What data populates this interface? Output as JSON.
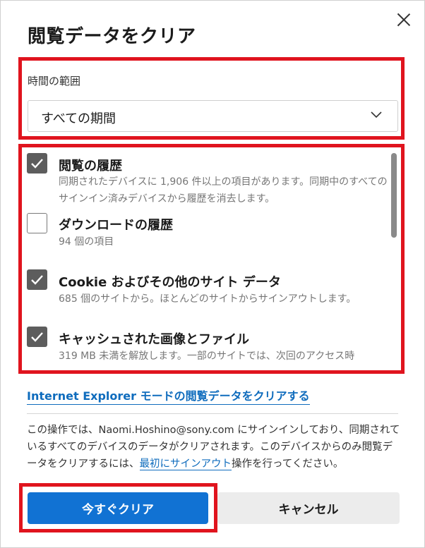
{
  "dialog": {
    "title": "閲覧データをクリア",
    "close_icon": "close-icon"
  },
  "time_range": {
    "label": "時間の範囲",
    "selected": "すべての期間"
  },
  "items": [
    {
      "title": "閲覧の履歴",
      "desc": "同期されたデバイスに 1,906 件以上の項目があります。同期中のすべてのサインイン済みデバイスから履歴を消去します。",
      "checked": true
    },
    {
      "title": "ダウンロードの履歴",
      "desc": "94 個の項目",
      "checked": false
    },
    {
      "title": "Cookie およびその他のサイト データ",
      "desc": "685 個のサイトから。ほとんどのサイトからサインアウトします。",
      "checked": true
    },
    {
      "title": "キャッシュされた画像とファイル",
      "desc": "319 MB 未満を解放します。一部のサイトでは、次回のアクセス時",
      "checked": true
    }
  ],
  "ie_link": "Internet Explorer モードの閲覧データをクリアする",
  "notice": {
    "before": "この操作では、Naomi.Hoshino@sony.com にサインインしており、同期されているすべてのデバイスのデータがクリアされます。このデバイスからのみ閲覧データをクリアするには、",
    "link": "最初にサインアウト",
    "after": "操作を行ってください。"
  },
  "buttons": {
    "clear_now": "今すぐクリア",
    "cancel": "キャンセル"
  },
  "colors": {
    "accent": "#1172d3",
    "link": "#0f6cbd",
    "highlight": "#e0141e",
    "checkbox": "#5d5d5d"
  }
}
